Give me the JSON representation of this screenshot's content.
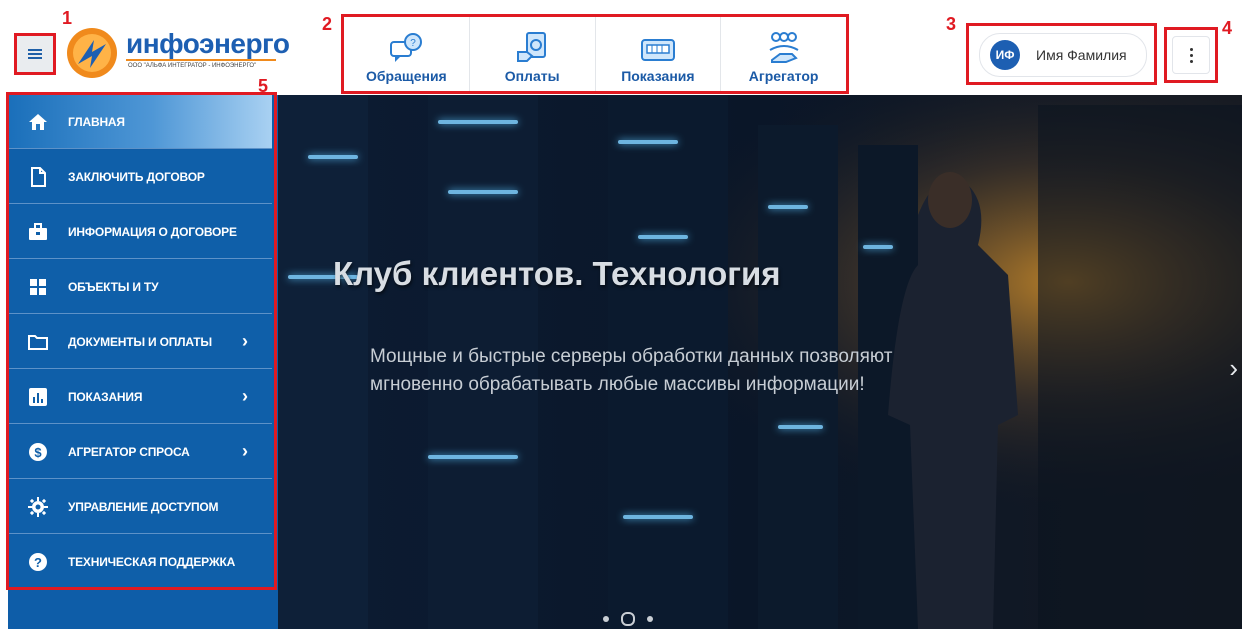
{
  "annotations": [
    "1",
    "2",
    "3",
    "4",
    "5"
  ],
  "logo": {
    "brand": "инфоэнерго",
    "subtitle": "ООО \"АЛЬФА ИНТЕГРАТОР - ИНФОЭНЕРГО\""
  },
  "top_nav": [
    {
      "label": "Обращения",
      "icon": "chat-question-icon"
    },
    {
      "label": "Оплаты",
      "icon": "payment-icon"
    },
    {
      "label": "Показания",
      "icon": "meter-icon"
    },
    {
      "label": "Агрегатор",
      "icon": "group-hand-icon"
    }
  ],
  "user": {
    "initials": "ИФ",
    "name": "Имя Фамилия"
  },
  "sidebar": {
    "items": [
      {
        "label": "ГЛАВНАЯ",
        "icon": "home-icon",
        "active": true,
        "submenu": false
      },
      {
        "label": "ЗАКЛЮЧИТЬ ДОГОВОР",
        "icon": "document-icon",
        "active": false,
        "submenu": false
      },
      {
        "label": "ИНФОРМАЦИЯ О ДОГОВОРЕ",
        "icon": "briefcase-icon",
        "active": false,
        "submenu": false
      },
      {
        "label": "ОБЪЕКТЫ И ТУ",
        "icon": "grid-icon",
        "active": false,
        "submenu": false
      },
      {
        "label": "ДОКУМЕНТЫ И ОПЛАТЫ",
        "icon": "folder-icon",
        "active": false,
        "submenu": true
      },
      {
        "label": "ПОКАЗАНИЯ",
        "icon": "bar-chart-icon",
        "active": false,
        "submenu": true
      },
      {
        "label": "АГРЕГАТОР СПРОСА",
        "icon": "dollar-icon",
        "active": false,
        "submenu": true
      },
      {
        "label": "УПРАВЛЕНИЕ ДОСТУПОМ",
        "icon": "gear-icon",
        "active": false,
        "submenu": false
      },
      {
        "label": "ТЕХНИЧЕСКАЯ ПОДДЕРЖКА",
        "icon": "help-icon",
        "active": false,
        "submenu": false
      }
    ]
  },
  "hero": {
    "title": "Клуб клиентов. Технология",
    "text": "Мощные и быстрые серверы обработки данных позволяют мгновенно обрабатывать любые массивы информации!",
    "slides_count": 3,
    "active_slide": 1
  },
  "colors": {
    "accent": "#1d5fb2",
    "sidebar": "#0f5fa9",
    "annotation": "#e01a22"
  }
}
